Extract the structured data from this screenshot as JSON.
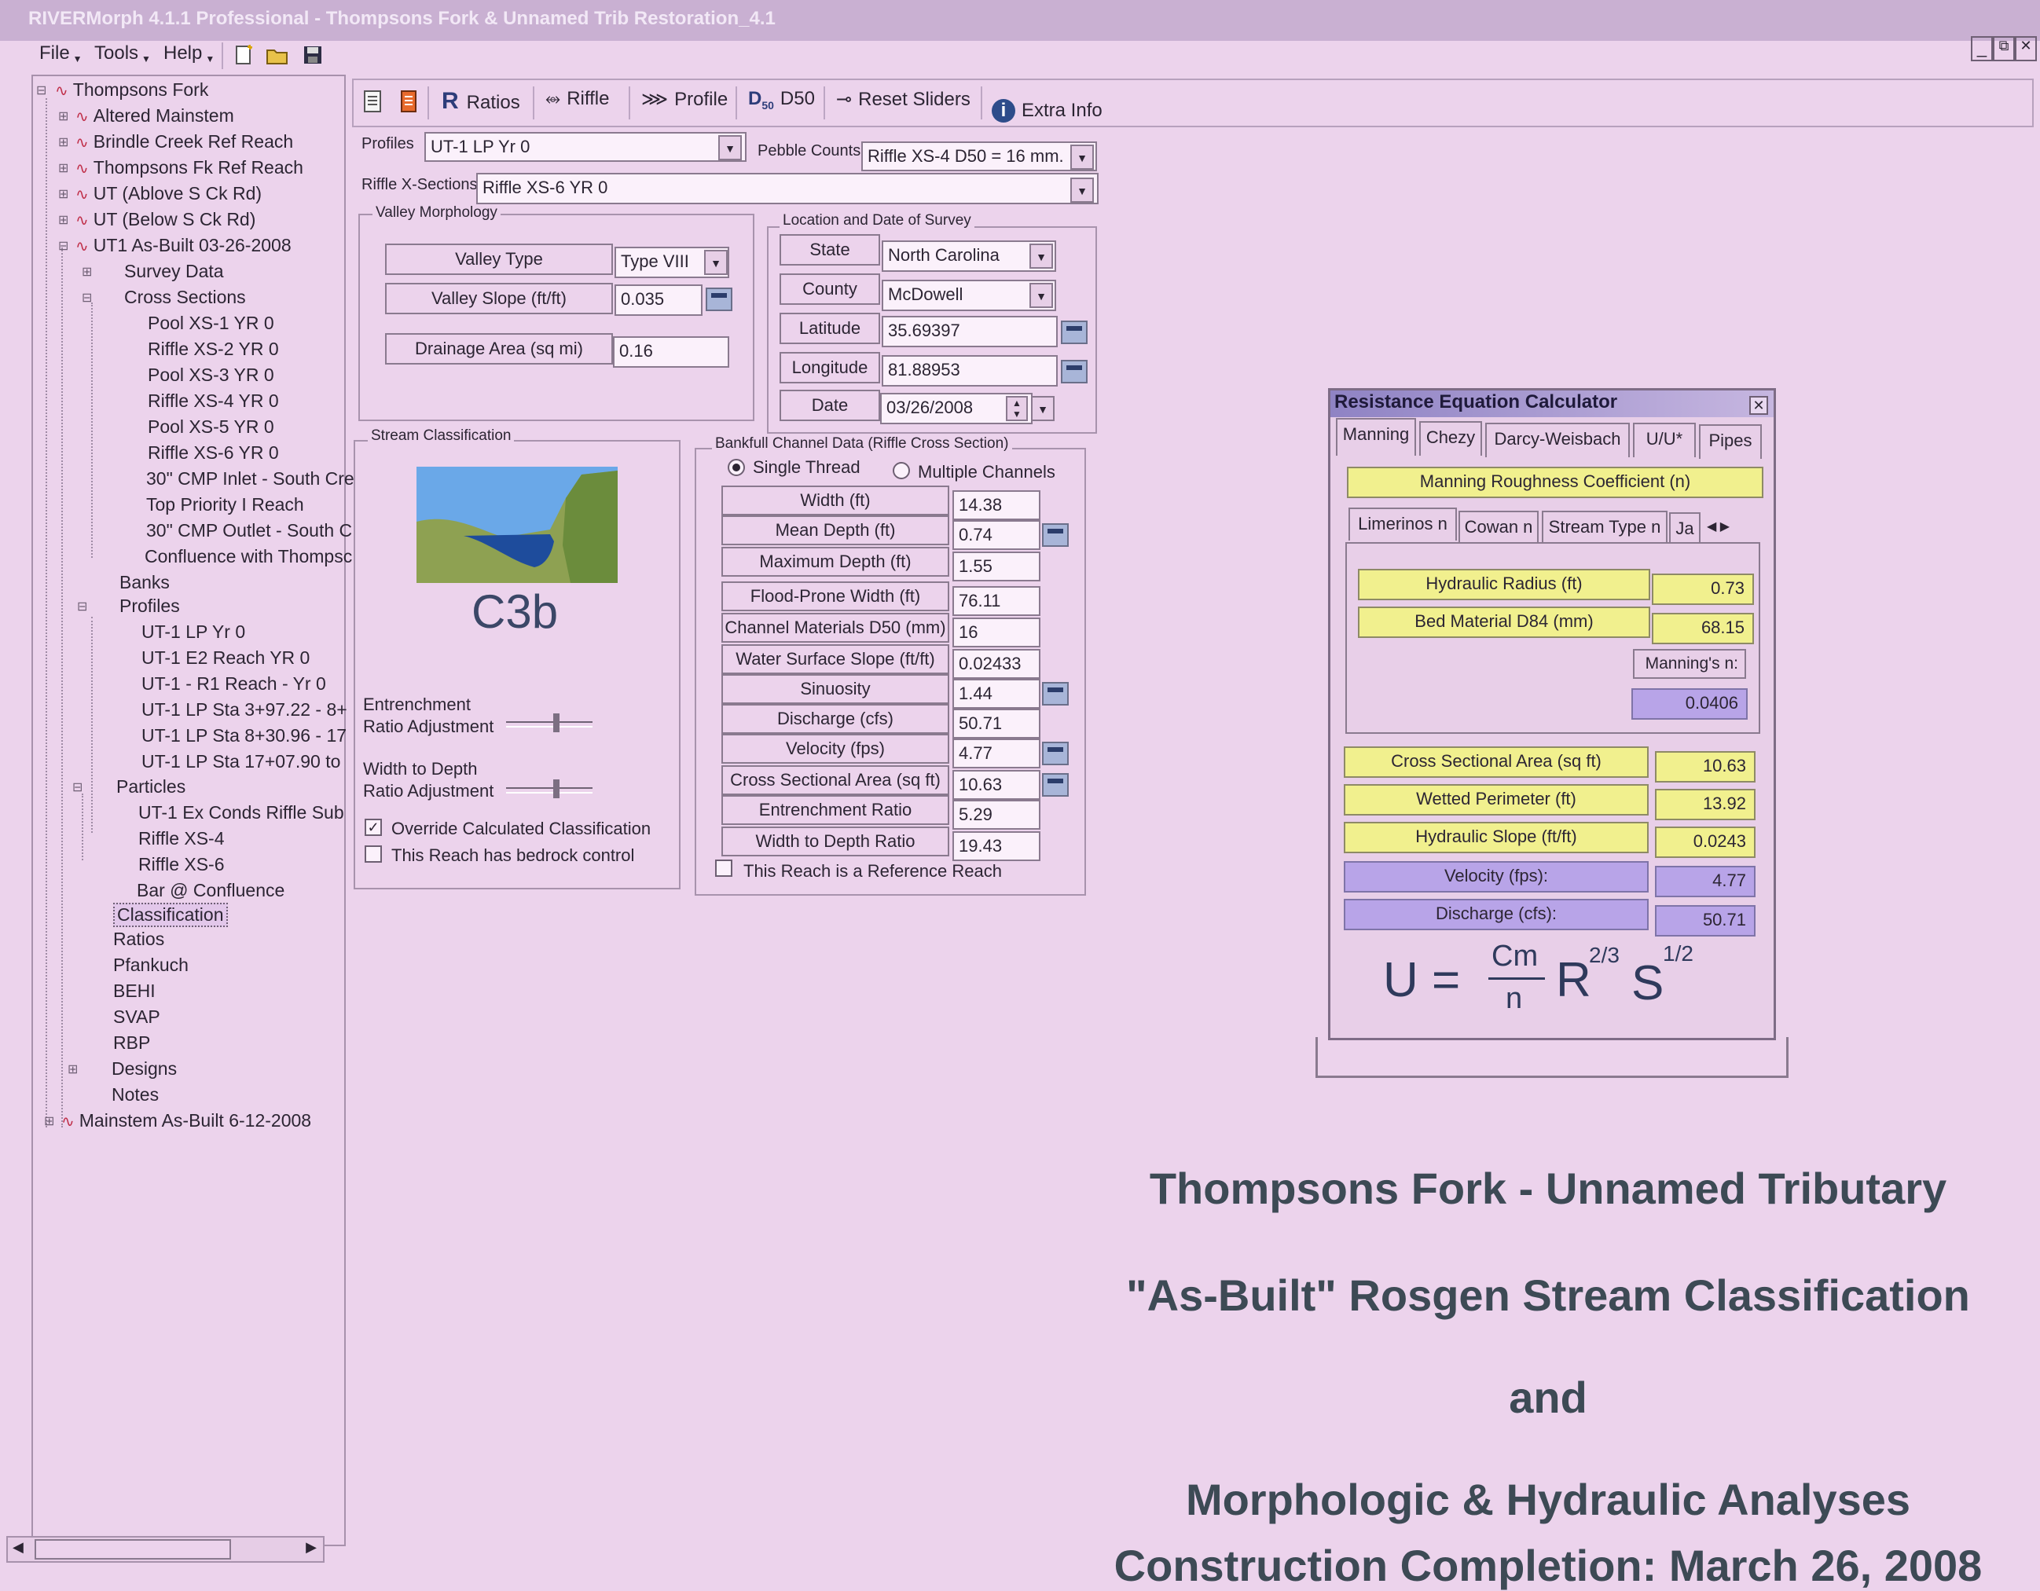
{
  "window": {
    "title": "RIVERMorph 4.1.1 Professional - Thompsons Fork & Unnamed Trib Restoration_4.1"
  },
  "menu": {
    "file": "File",
    "tools": "Tools",
    "help": "Help"
  },
  "window_controls": {
    "minimize": "_",
    "restore": "⧉",
    "close": "✕"
  },
  "tree": {
    "root": "Thompsons Fork",
    "reaches": [
      "Altered Mainstem",
      "Brindle Creek Ref Reach",
      "Thompsons Fk Ref Reach",
      "UT (Ablove S Ck Rd)",
      "UT (Below S Ck Rd)",
      "UT1 As-Built 03-26-2008"
    ],
    "survey_data": "Survey Data",
    "cross_sections": "Cross Sections",
    "xs_items": [
      "Pool XS-1 YR 0",
      "Riffle XS-2 YR 0",
      "Pool XS-3 YR 0",
      "Riffle XS-4 YR 0",
      "Pool XS-5 YR 0",
      "Riffle XS-6 YR 0",
      "30\" CMP Inlet - South Cre",
      "Top Priority I Reach",
      "30\" CMP Outlet - South C",
      "Confluence with Thompsc"
    ],
    "banks": "Banks",
    "profiles": "Profiles",
    "profile_items": [
      "UT-1 LP Yr 0",
      "UT-1 E2 Reach YR 0",
      "UT-1 - R1 Reach - Yr 0",
      "UT-1 LP Sta 3+97.22 - 8+",
      "UT-1 LP Sta 8+30.96 - 17",
      "UT-1 LP Sta 17+07.90 to"
    ],
    "particles": "Particles",
    "particle_items": [
      "UT-1 Ex Conds Riffle Sub",
      "Riffle XS-4",
      "Riffle XS-6",
      "Bar @ Confluence"
    ],
    "classification": "Classification",
    "other_items": [
      "Ratios",
      "Pfankuch",
      "BEHI",
      "SVAP",
      "RBP"
    ],
    "designs": "Designs",
    "notes": "Notes",
    "last_reach": "Mainstem As-Built 6-12-2008"
  },
  "toolbar": {
    "ratios": "Ratios",
    "riffle": "Riffle",
    "profile": "Profile",
    "d50": "D50",
    "reset_sliders": "Reset Sliders",
    "extra_info": "Extra Info"
  },
  "selectors": {
    "profiles_label": "Profiles",
    "profiles_value": "UT-1 LP Yr 0",
    "pebble_label": "Pebble Counts:",
    "pebble_value": "Riffle XS-4 D50 = 16 mm.",
    "riffle_label": "Riffle X-Sections:",
    "riffle_value": "Riffle XS-6 YR 0"
  },
  "valley": {
    "group_title": "Valley Morphology",
    "type_label": "Valley Type",
    "type_value": "Type VIII",
    "slope_label": "Valley Slope (ft/ft)",
    "slope_value": "0.035",
    "drainage_label": "Drainage Area (sq mi)",
    "drainage_value": "0.16"
  },
  "location": {
    "group_title": "Location and Date of Survey",
    "state_label": "State",
    "state_value": "North Carolina",
    "county_label": "County",
    "county_value": "McDowell",
    "lat_label": "Latitude",
    "lat_value": "35.69397",
    "lon_label": "Longitude",
    "lon_value": "81.88953",
    "date_label": "Date",
    "date_value": "03/26/2008"
  },
  "classification": {
    "group_title": "Stream Classification",
    "stream_type": "C3b",
    "entrenchment_adj": [
      "Entrenchment",
      "Ratio Adjustment"
    ],
    "wd_adj": [
      "Width to Depth",
      "Ratio Adjustment"
    ],
    "override_label": "Override Calculated Classification",
    "override_checked": true,
    "bedrock_label": "This Reach has bedrock control",
    "bedrock_checked": false
  },
  "bankfull": {
    "group_title": "Bankfull Channel Data (Riffle Cross Section)",
    "single_thread": "Single Thread",
    "multiple_channels": "Multiple Channels",
    "rows": [
      {
        "label": "Width (ft)",
        "value": "14.38"
      },
      {
        "label": "Mean Depth (ft)",
        "value": "0.74"
      },
      {
        "label": "Maximum Depth (ft)",
        "value": "1.55"
      },
      {
        "label": "Flood-Prone Width (ft)",
        "value": "76.11"
      },
      {
        "label": "Channel Materials D50 (mm)",
        "value": "16"
      },
      {
        "label": "Water Surface Slope (ft/ft)",
        "value": "0.02433"
      },
      {
        "label": "Sinuosity",
        "value": "1.44"
      },
      {
        "label": "Discharge (cfs)",
        "value": "50.71"
      },
      {
        "label": "Velocity (fps)",
        "value": "4.77"
      },
      {
        "label": "Cross Sectional Area (sq ft)",
        "value": "10.63"
      },
      {
        "label": "Entrenchment Ratio",
        "value": "5.29"
      },
      {
        "label": "Width to Depth Ratio",
        "value": "19.43"
      }
    ],
    "reference_label": "This Reach is a Reference Reach",
    "reference_checked": false
  },
  "calculator": {
    "title": "Resistance Equation Calculator",
    "tabs": [
      "Manning",
      "Chezy",
      "Darcy-Weisbach",
      "U/U*",
      "Pipes"
    ],
    "coef_title": "Manning Roughness Coefficient (n)",
    "subtabs": [
      "Limerinos n",
      "Cowan n",
      "Stream Type n",
      "Ja"
    ],
    "hydraulic_radius_label": "Hydraulic Radius (ft)",
    "hydraulic_radius_value": "0.73",
    "d84_label": "Bed Material D84 (mm)",
    "d84_value": "68.15",
    "mannings_n_label": "Manning's n:",
    "mannings_n_value": "0.0406",
    "area_label": "Cross Sectional Area (sq ft)",
    "area_value": "10.63",
    "perimeter_label": "Wetted Perimeter (ft)",
    "perimeter_value": "13.92",
    "slope_label": "Hydraulic Slope (ft/ft)",
    "slope_value": "0.0243",
    "velocity_label": "Velocity (fps):",
    "velocity_value": "4.77",
    "discharge_label": "Discharge (cfs):",
    "discharge_value": "50.71",
    "formula": {
      "u": "U =",
      "cm": "Cm",
      "n": "n",
      "r": "R",
      "r_exp": "2/3",
      "s": "S",
      "s_exp": "1/2"
    }
  },
  "headline": {
    "line1": "Thompsons Fork - Unnamed Tributary",
    "line2": "\"As-Built\" Rosgen Stream Classification",
    "line3": "and",
    "line4": "Morphologic & Hydraulic Analyses",
    "line5": "Construction Completion: March 26, 2008"
  },
  "colors": {
    "background": "#ecd3ec",
    "highlight_yellow": "#f1f08e",
    "highlight_purple": "#b8a4e8",
    "headline": "#3d4a55"
  }
}
